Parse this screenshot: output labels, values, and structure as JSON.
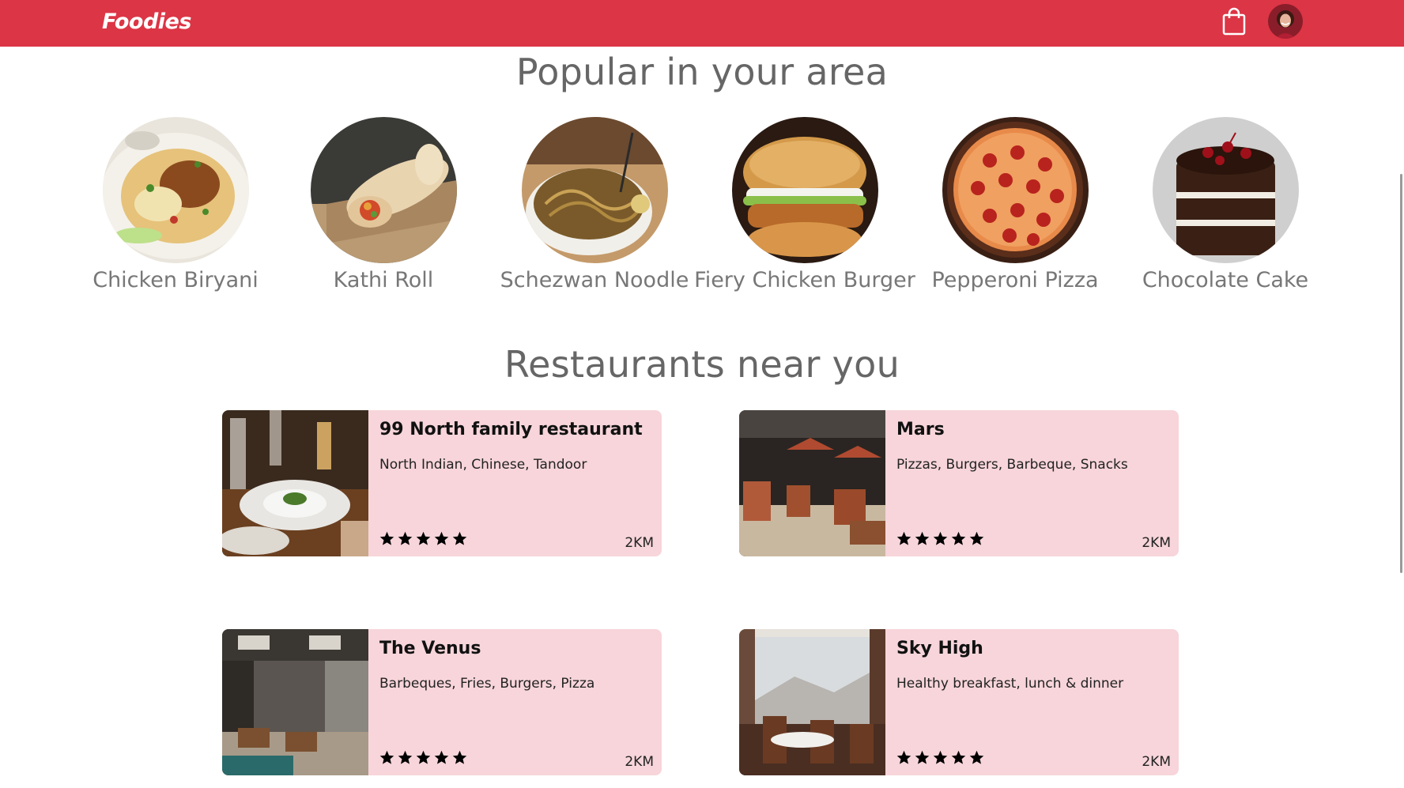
{
  "header": {
    "brand": "Foodies",
    "cart_icon": "shopping-bag-icon",
    "avatar_icon": "user-avatar"
  },
  "colors": {
    "header_bg": "#dc3545",
    "card_bg": "#f7d5da",
    "heading": "#666666"
  },
  "popular": {
    "title": "Popular in your area",
    "items": [
      {
        "name": "Chicken Biryani"
      },
      {
        "name": "Kathi Roll"
      },
      {
        "name": "Schezwan Noodle"
      },
      {
        "name": "Fiery Chicken Burger"
      },
      {
        "name": "Pepperoni Pizza"
      },
      {
        "name": "Chocolate Cake"
      }
    ]
  },
  "restaurants": {
    "title": "Restaurants near you",
    "items": [
      {
        "name": "99 North family restaurant",
        "cuisine": "North Indian, Chinese, Tandoor",
        "rating": 5,
        "distance": "2KM"
      },
      {
        "name": "Mars",
        "cuisine": "Pizzas, Burgers, Barbeque, Snacks",
        "rating": 5,
        "distance": "2KM"
      },
      {
        "name": "The Venus",
        "cuisine": "Barbeques, Fries, Burgers, Pizza",
        "rating": 5,
        "distance": "2KM"
      },
      {
        "name": "Sky High",
        "cuisine": "Healthy breakfast, lunch & dinner",
        "rating": 5,
        "distance": "2KM"
      }
    ]
  }
}
